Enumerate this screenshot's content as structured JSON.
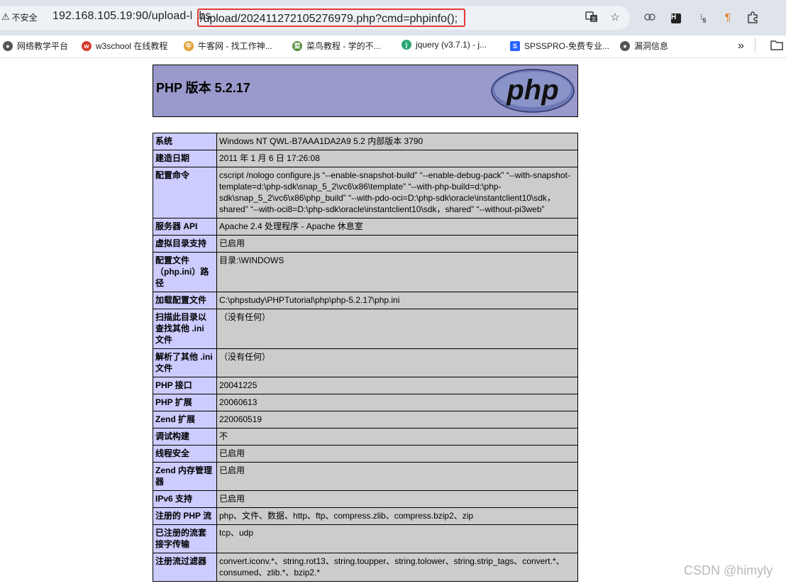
{
  "browser": {
    "insecure_label": "不安全",
    "url_host": "192.168.105.19:90/upload-labs",
    "url_path": "/upload/202411272105276979.php?cmd=phpinfo();",
    "ext_badge": "5"
  },
  "bookmarks": [
    {
      "label": "网络教学平台",
      "icon": "globe-icon",
      "color": "#555555"
    },
    {
      "label": "w3school 在线教程",
      "icon": "w3school-icon",
      "color": "#d33a2c"
    },
    {
      "label": "牛客网 - 找工作神...",
      "icon": "nowcoder-icon",
      "color": "#e0a030"
    },
    {
      "label": "菜鸟教程 - 学的不...",
      "icon": "runoob-icon",
      "color": "#5a8f3c"
    },
    {
      "label": "jquery (v3.7.1) - j...",
      "icon": "jquery-icon",
      "color": "#2aa876"
    },
    {
      "label": "SPSSPRO-免费专业...",
      "icon": "spsspro-icon",
      "color": "#2962ff"
    },
    {
      "label": "漏洞信息",
      "icon": "globe-icon",
      "color": "#555555"
    }
  ],
  "php": {
    "title": "PHP 版本 5.2.17",
    "logo_text": "php",
    "rows": [
      {
        "key": "系统",
        "value": "Windows NT QWL-B7AAA1DA2A9 5.2 内部版本 3790"
      },
      {
        "key": "建造日期",
        "value": "2011 年 1 月 6 日 17:26:08"
      },
      {
        "key": "配置命令",
        "value": "cscript /nologo configure.js “--enable-snapshot-build”  “--enable-debug-pack”  “--with-snapshot-template=d:\\php-sdk\\snap_5_2\\vc6\\x86\\template”  “--with-php-build=d:\\php-sdk\\snap_5_2\\vc6\\x86\\php_build”  “--with-pdo-oci=D:\\php-sdk\\oracle\\instantclient10\\sdk，shared”  “--with-oci8=D:\\php-sdk\\oracle\\instantclient10\\sdk，shared”  “--without-pi3web”"
      },
      {
        "key": "服务器 API",
        "value": "Apache 2.4 处理程序 - Apache 休息室"
      },
      {
        "key": "虚拟目录支持",
        "value": "已启用"
      },
      {
        "key": "配置文件（php.ini）路径",
        "value": "目录:\\WINDOWS"
      },
      {
        "key": "加载配置文件",
        "value": "C:\\phpstudy\\PHPTutorial\\php\\php-5.2.17\\php.ini"
      },
      {
        "key": "扫描此目录以查找其他 .ini 文件",
        "value": "（没有任何）"
      },
      {
        "key": "解析了其他 .ini 文件",
        "value": "（没有任何）"
      },
      {
        "key": "PHP 接口",
        "value": "20041225"
      },
      {
        "key": "PHP 扩展",
        "value": "20060613"
      },
      {
        "key": "Zend 扩展",
        "value": "220060519"
      },
      {
        "key": "调试构建",
        "value": "不"
      },
      {
        "key": "线程安全",
        "value": "已启用"
      },
      {
        "key": "Zend 内存管理器",
        "value": "已启用"
      },
      {
        "key": "IPv6 支持",
        "value": "已启用"
      },
      {
        "key": "注册的 PHP 流",
        "value": "php、文件、数据、http、ftp、compress.zlib、compress.bzip2、zip"
      },
      {
        "key": "已注册的流套接字传输",
        "value": "tcp、udp"
      },
      {
        "key": "注册流过滤器",
        "value": "convert.iconv.*、string.rot13、string.toupper、string.tolower、string.strip_tags、convert.*、consumed、zlib.*、bzip2.*"
      }
    ]
  },
  "watermark": "CSDN @himyly"
}
